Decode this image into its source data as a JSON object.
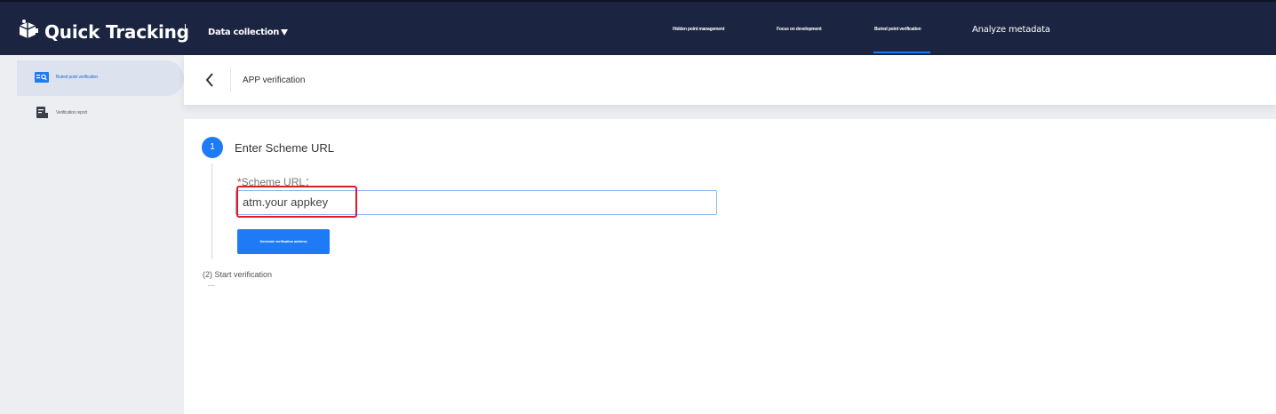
{
  "header": {
    "brand": "Quick Tracking",
    "section_dropdown": "Data collection",
    "nav": [
      {
        "label": "Hidden point management",
        "active": false
      },
      {
        "label": "Focus on development",
        "active": false
      },
      {
        "label": "Buried point verification",
        "active": true
      },
      {
        "label": "Analyze metadata",
        "active": false
      }
    ]
  },
  "sidebar": {
    "items": [
      {
        "label": "Buried point verification",
        "icon": "verification-icon",
        "active": true
      },
      {
        "label": "Verification report",
        "icon": "report-icon",
        "active": false
      }
    ]
  },
  "page": {
    "title": "APP verification",
    "step1": {
      "number": "1",
      "title": "Enter Scheme URL",
      "field_required_mark": "*",
      "field_label": "Scheme URL：",
      "field_value": "atm.your appkey",
      "button_label": "Generate verification address"
    },
    "step2": {
      "title": "(2) Start verification"
    }
  },
  "colors": {
    "topbar": "#1b2541",
    "accent": "#1e7bf5",
    "highlight": "#e01b24"
  }
}
